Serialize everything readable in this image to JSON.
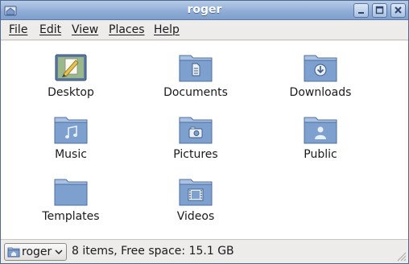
{
  "window": {
    "title": "roger"
  },
  "menu": {
    "items": [
      "File",
      "Edit",
      "View",
      "Places",
      "Help"
    ]
  },
  "files": [
    {
      "name": "Desktop",
      "icon": "desktop-folder-icon"
    },
    {
      "name": "Documents",
      "icon": "documents-folder-icon"
    },
    {
      "name": "Downloads",
      "icon": "downloads-folder-icon"
    },
    {
      "name": "Music",
      "icon": "music-folder-icon"
    },
    {
      "name": "Pictures",
      "icon": "pictures-folder-icon"
    },
    {
      "name": "Public",
      "icon": "public-folder-icon"
    },
    {
      "name": "Templates",
      "icon": "templates-folder-icon"
    },
    {
      "name": "Videos",
      "icon": "videos-folder-icon"
    }
  ],
  "statusbar": {
    "location": "roger",
    "info": "8 items, Free space: 15.1 GB"
  },
  "colors": {
    "titlebar": "#8eabd5",
    "folder_body": "#7ea0cf",
    "folder_tab": "#a9c1e3"
  }
}
